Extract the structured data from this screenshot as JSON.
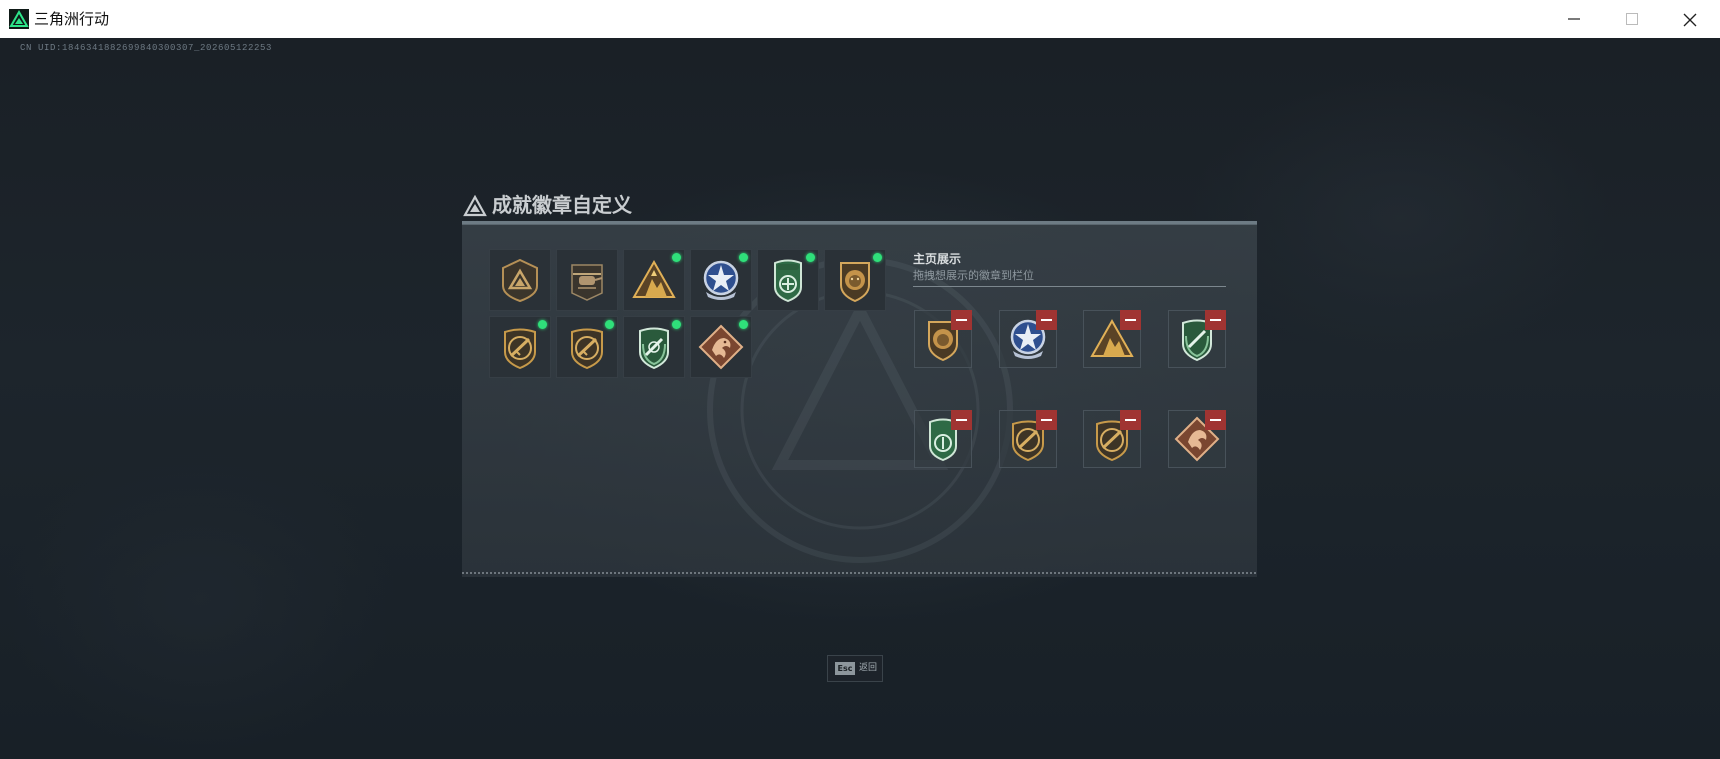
{
  "window": {
    "title": "三角洲行动",
    "controls": [
      "minimize-icon",
      "maximize-icon",
      "close-icon"
    ]
  },
  "overlay": {
    "uid_text": "CN UID:1846341882699840300307_202605122253"
  },
  "dialog": {
    "title": "成就徽章自定义",
    "inventory": {
      "badges": [
        {
          "icon": "delta-triangle-badge-icon",
          "new": false
        },
        {
          "icon": "helicopter-badge-icon",
          "new": false
        },
        {
          "icon": "mountain-gold-badge-icon",
          "new": true
        },
        {
          "icon": "star-wings-badge-icon",
          "new": true
        },
        {
          "icon": "green-crest-badge-icon",
          "new": true
        },
        {
          "icon": "lion-shield-badge-icon",
          "new": true
        },
        {
          "icon": "rifle-shield-badge-icon",
          "new": true
        },
        {
          "icon": "rifle-shield-badge-icon",
          "new": true
        },
        {
          "icon": "green-wreath-badge-icon",
          "new": true
        },
        {
          "icon": "dragon-diamond-badge-icon",
          "new": true
        }
      ]
    },
    "showcase": {
      "title": "主页展示",
      "subtitle": "拖拽想展示的徽章到栏位",
      "slots": [
        {
          "icon": "lion-shield-badge-icon",
          "remove_icon": "minus-icon"
        },
        {
          "icon": "star-wings-badge-icon",
          "remove_icon": "minus-icon"
        },
        {
          "icon": "mountain-gold-badge-icon",
          "remove_icon": "minus-icon"
        },
        {
          "icon": "green-wreath-badge-icon",
          "remove_icon": "minus-icon"
        },
        {
          "icon": "green-crest-badge-icon",
          "remove_icon": "minus-icon"
        },
        {
          "icon": "rifle-shield-badge-icon",
          "remove_icon": "minus-icon"
        },
        {
          "icon": "rifle-shield-badge-icon",
          "remove_icon": "minus-icon"
        },
        {
          "icon": "dragon-diamond-badge-icon",
          "remove_icon": "minus-icon"
        }
      ]
    }
  },
  "footer": {
    "esc_key": "Esc",
    "esc_label": "返回"
  },
  "colors": {
    "new_dot": "#2fe07a",
    "remove_button": "#a03432",
    "gold": "#c79a4a",
    "green": "#3e8a5a"
  }
}
